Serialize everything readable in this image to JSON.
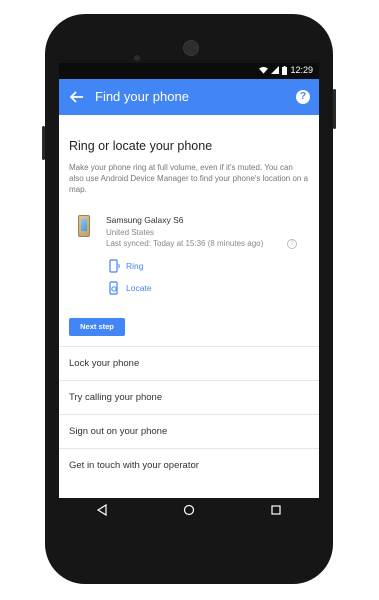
{
  "status_bar": {
    "time": "12:29"
  },
  "app_bar": {
    "title": "Find your phone",
    "help_glyph": "?"
  },
  "main": {
    "heading": "Ring or locate your phone",
    "description": "Make your phone ring at full volume, even if it's muted. You can also use Android Device Manager to find your phone's location on a map.",
    "device": {
      "name": "Samsung Galaxy S6",
      "country": "United States",
      "last_synced": "Last synced: Today at 15:36 (8 minutes ago)"
    },
    "actions": {
      "ring": "Ring",
      "locate": "Locate"
    },
    "next_button": "Next step"
  },
  "list_items": [
    "Lock your phone",
    "Try calling your phone",
    "Sign out on your phone",
    "Get in touch with your operator"
  ],
  "colors": {
    "accent": "#4285f4",
    "phone_body": "#161616"
  }
}
